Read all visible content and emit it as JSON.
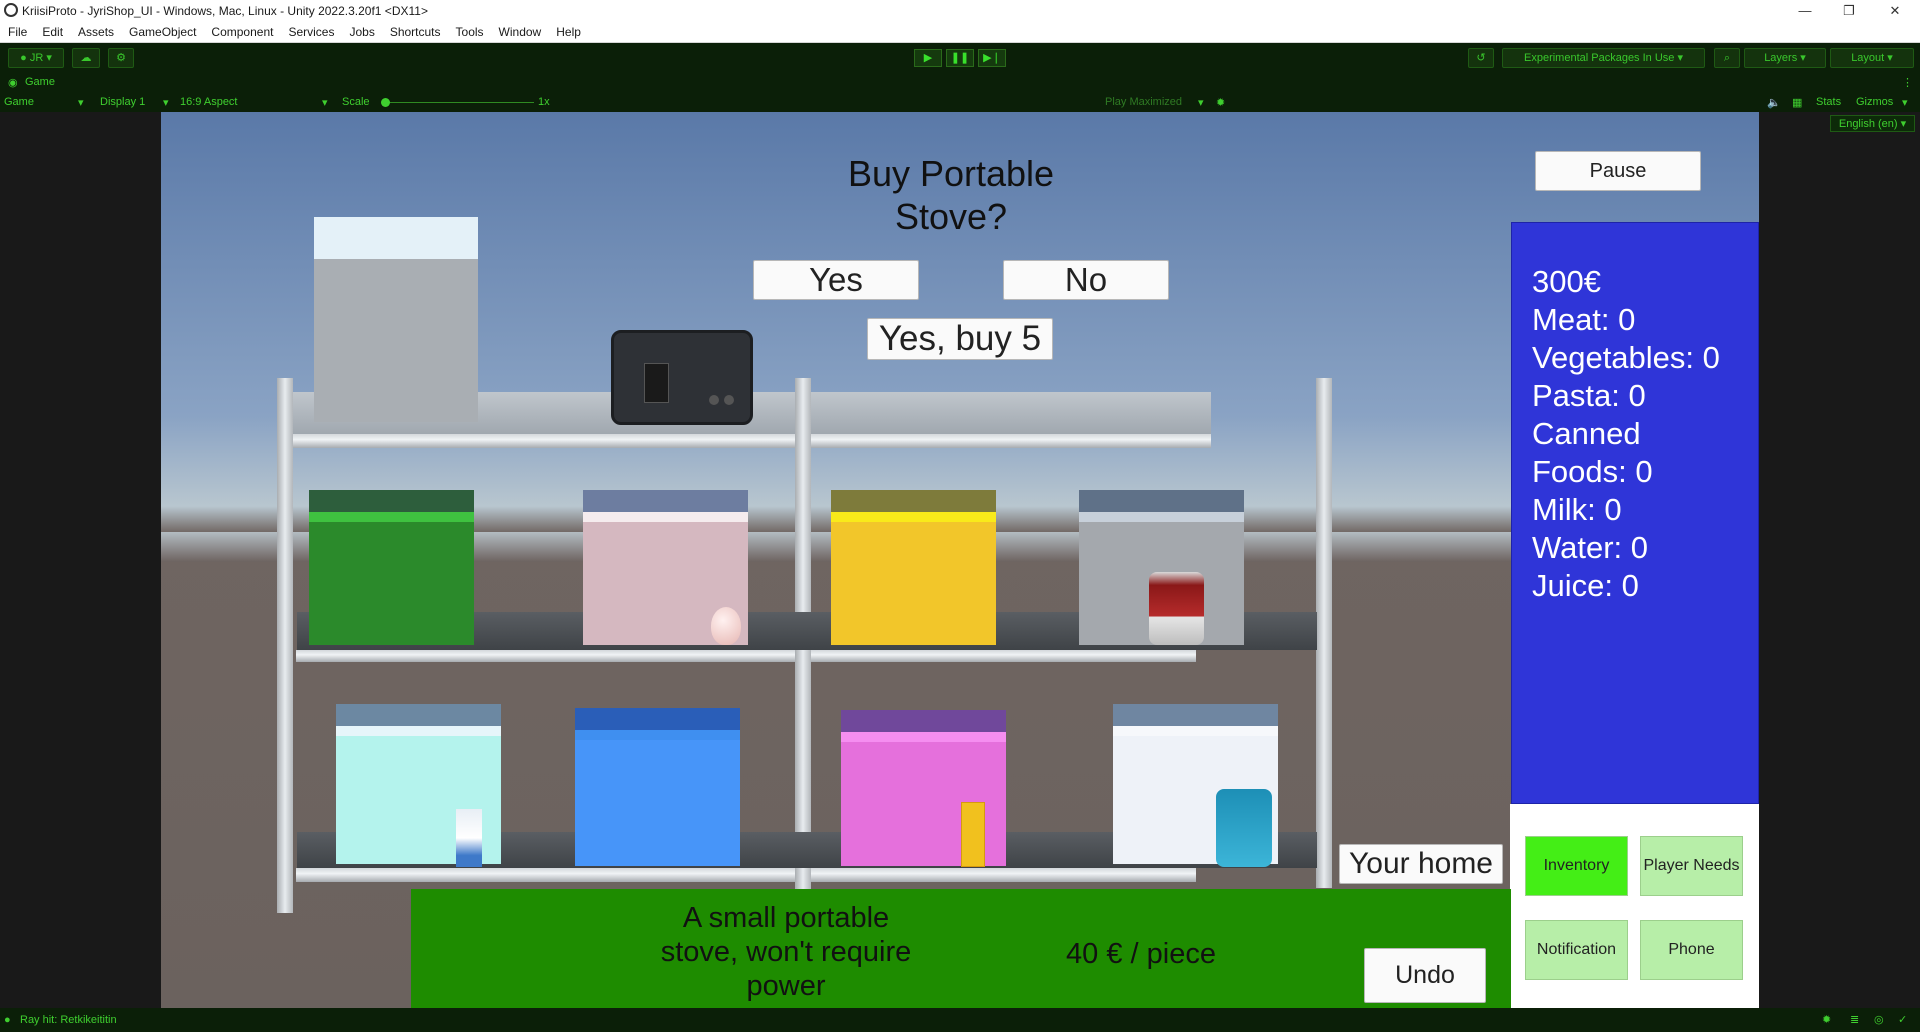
{
  "window": {
    "title": "KriisiProto - JyriShop_UI - Windows, Mac, Linux - Unity 2022.3.20f1 <DX11>",
    "controls": [
      "—",
      "❐",
      "✕"
    ]
  },
  "menu": [
    "File",
    "Edit",
    "Assets",
    "GameObject",
    "Component",
    "Services",
    "Jobs",
    "Shortcuts",
    "Tools",
    "Window",
    "Help"
  ],
  "toolbar": {
    "account": "JR",
    "packages": "Experimental Packages In Use",
    "layers": "Layers",
    "layout": "Layout"
  },
  "game_view": {
    "tab_label": "Game",
    "mode": "Game",
    "display": "Display 1",
    "aspect": "16:9 Aspect",
    "scale_label": "Scale",
    "scale_value": "1x",
    "play_mode": "Play Maximized",
    "stats": "Stats",
    "gizmos": "Gizmos",
    "language": "English (en)"
  },
  "game_ui": {
    "prompt": "Buy Portable Stove?",
    "yes": "Yes",
    "no": "No",
    "yes_buy_5": "Yes, buy 5",
    "pause": "Pause",
    "inventory_lines": [
      "300€",
      "Meat: 0",
      "Vegetables: 0",
      "Pasta: 0",
      "Canned Foods: 0",
      "Milk: 0",
      "Water: 0",
      "Juice: 0"
    ],
    "your_home": "Your home",
    "description": "A small portable stove, won't require power",
    "price": "40 € / piece",
    "undo": "Undo",
    "tabs": {
      "inventory": "Inventory",
      "player_needs": "Player Needs",
      "notification": "Notification",
      "phone": "Phone"
    }
  },
  "status": {
    "message": "Ray hit: Retkikeititin"
  },
  "colors": {
    "inventory_panel": "#2f35d8",
    "description_bar": "#1e8c00",
    "active_tab": "#44ee16",
    "inactive_tab": "#b7eea8"
  }
}
